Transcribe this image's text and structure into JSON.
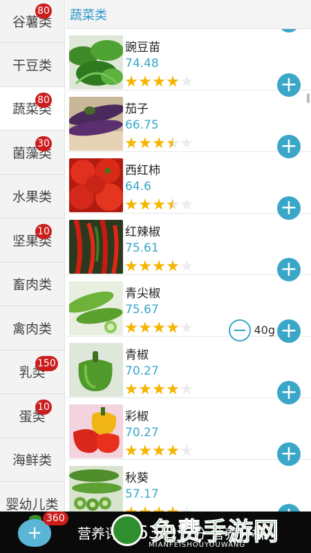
{
  "sidebar": {
    "categories": [
      {
        "label": "谷薯类",
        "badge": "80"
      },
      {
        "label": "干豆类",
        "badge": ""
      },
      {
        "label": "蔬菜类",
        "badge": "80"
      },
      {
        "label": "菌藻类",
        "badge": "30"
      },
      {
        "label": "水果类",
        "badge": ""
      },
      {
        "label": "坚果类",
        "badge": "10"
      },
      {
        "label": "畜肉类",
        "badge": ""
      },
      {
        "label": "禽肉类",
        "badge": ""
      },
      {
        "label": "乳类",
        "badge": "150"
      },
      {
        "label": "蛋类",
        "badge": "10"
      },
      {
        "label": "海鲜类",
        "badge": ""
      },
      {
        "label": "婴幼儿类",
        "badge": ""
      }
    ]
  },
  "main": {
    "header_title": "蔬菜类",
    "foods": [
      {
        "name": "豌豆苗",
        "score": "74.48",
        "rating": 4
      },
      {
        "name": "茄子",
        "score": "66.75",
        "rating": 3.5
      },
      {
        "name": "西红柿",
        "score": "64.6",
        "rating": 3.5
      },
      {
        "name": "红辣椒",
        "score": "75.61",
        "rating": 4
      },
      {
        "name": "青尖椒",
        "score": "75.67",
        "rating": 4,
        "quantity": "40g"
      },
      {
        "name": "青椒",
        "score": "70.27",
        "rating": 4
      },
      {
        "name": "彩椒",
        "score": "70.27",
        "rating": 4
      },
      {
        "name": "秋葵",
        "score": "57.17",
        "rating": 4
      }
    ]
  },
  "bottom": {
    "cart_count": "360",
    "summary_label": "营养评分",
    "summary_value": "63.97",
    "summary_unit": "分",
    "summary_action": "营养分析",
    "watermark_text": "免费手游网",
    "watermark_sub": "MIANFEISHOUYOUWANG"
  },
  "colors": {
    "accent": "#3aa7c9",
    "badge": "#cc1d1d",
    "star": "#f5b400",
    "bottom_bar": "#0a0a0a"
  }
}
